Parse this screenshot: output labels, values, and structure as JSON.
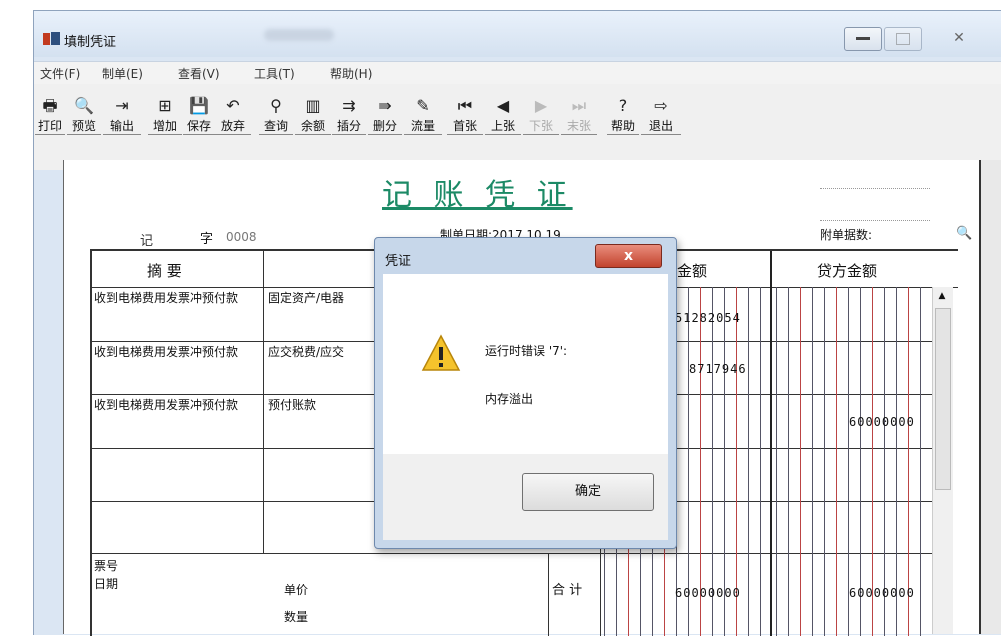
{
  "window": {
    "title": "填制凭证"
  },
  "menu": [
    "文件(F)",
    "制单(E)",
    "查看(V)",
    "工具(T)",
    "帮助(H)"
  ],
  "toolbar": [
    {
      "label": "打印",
      "icon": "🖶",
      "enabled": true
    },
    {
      "label": "预览",
      "icon": "🔍",
      "enabled": true
    },
    {
      "label": "输出",
      "icon": "⇥",
      "enabled": true
    },
    {
      "label": "增加",
      "icon": "⊞",
      "enabled": true
    },
    {
      "label": "保存",
      "icon": "💾",
      "enabled": true
    },
    {
      "label": "放弃",
      "icon": "↶",
      "enabled": true
    },
    {
      "label": "查询",
      "icon": "⚲",
      "enabled": true
    },
    {
      "label": "余额",
      "icon": "▥",
      "enabled": true
    },
    {
      "label": "插分",
      "icon": "⇉",
      "enabled": true
    },
    {
      "label": "删分",
      "icon": "⇛",
      "enabled": true
    },
    {
      "label": "流量",
      "icon": "✎",
      "enabled": true
    },
    {
      "label": "首张",
      "icon": "⏮",
      "enabled": true
    },
    {
      "label": "上张",
      "icon": "◀",
      "enabled": true
    },
    {
      "label": "下张",
      "icon": "▶",
      "enabled": false
    },
    {
      "label": "末张",
      "icon": "⏭",
      "enabled": false
    },
    {
      "label": "帮助",
      "icon": "?",
      "enabled": true
    },
    {
      "label": "退出",
      "icon": "⇨",
      "enabled": true
    }
  ],
  "voucher": {
    "title": "记 账 凭 证",
    "type_char": "记",
    "zi": "字",
    "number": "0008",
    "date_label": "制单日期:2017.10.19",
    "attach_label": "附单据数:",
    "headers": {
      "summary": "摘 要",
      "debit": "金额",
      "credit": "贷方金额"
    },
    "rows": [
      {
        "summary": "收到电梯费用发票冲预付款",
        "account": "固定资产/电器",
        "debit": "51282054",
        "credit": ""
      },
      {
        "summary": "收到电梯费用发票冲预付款",
        "account": "应交税费/应交",
        "debit": "8717946",
        "credit": ""
      },
      {
        "summary": "收到电梯费用发票冲预付款",
        "account": "预付账款",
        "debit": "",
        "credit": "60000000"
      }
    ],
    "footer": {
      "ticket": "票号",
      "date": "日期",
      "price": "单价",
      "qty": "数量",
      "total_label": "合 计",
      "total_debit": "60000000",
      "total_credit": "60000000"
    }
  },
  "dialog": {
    "title": "凭证",
    "close": "x",
    "message1": "运行时错误 '7':",
    "message2": "内存溢出",
    "ok": "确定"
  }
}
